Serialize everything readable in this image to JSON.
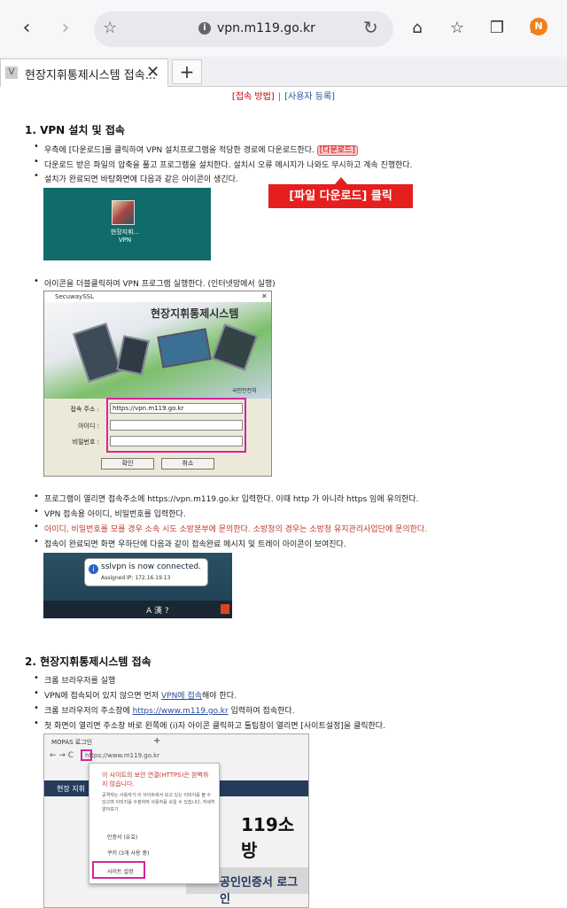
{
  "browser": {
    "url": "vpn.m119.go.kr",
    "tab_title": "현장지휘통제시스템 접속...",
    "tab_favicon": "V",
    "profile_badge": "N",
    "icons": [
      "back-arrow-icon",
      "forward-arrow-icon",
      "bookmark-star-icon",
      "site-info-icon",
      "reload-icon",
      "home-icon",
      "favorites-icon",
      "tabs-icon",
      "menu-icon"
    ]
  },
  "topnav": {
    "link1": "[접속 방법]",
    "sep": "|",
    "link2": "[사용자 등록]"
  },
  "section1": {
    "heading": "1. VPN 설치 및 접속",
    "items": [
      "우측에 [다운로드]를 클릭하여 VPN 설치프로그램을 적당한 경로에 다운로드한다.",
      "다운로드 받은 파일의 압축을 풀고 프로그램을 설치한다. 설치시 오류 메시지가 나와도 무시하고 계속 진행한다.",
      "설치가 완료되면 바탕화면에 다음과 같은 아이콘이 생긴다.",
      "아이콘을 더블클릭하여 VPN 프로그램 실행한다. (인터넷망에서 실행)",
      "프로그램이 열리면 접속주소에 https://vpn.m119.go.kr 입력한다. 이때 http 가 아니라 https 임에 유의한다.",
      "VPN 접속용 아이디, 비밀번호를 입력한다.",
      "아이디, 비밀번호를 모를 경우 소속 시도 소방본부에 문의한다. 소방청의 경우는 소방청 유지관리사업단에 문의한다.",
      "접속이 완료되면 화면 우하단에 다음과 같이 접속완료 메시지 및 트레이 아이콘이 보여진다."
    ],
    "download_btn": "[다운로드]",
    "callout": "[파일 다운로드] 클릭",
    "desktop_icon_label": "현장지휘...\nVPN"
  },
  "vpn_window": {
    "title": "SecuwaySSL",
    "banner_title": "현장지휘통제시스템",
    "org": "국민안전처",
    "addr_label": "접속 주소 :",
    "addr_value": "https://vpn.m119.go.kr",
    "id_label": "아이디 :",
    "pw_label": "비밀번호 :",
    "ok": "확인",
    "cancel": "취소"
  },
  "tray": {
    "msg": "sslvpn is now connected.",
    "ip": "Assigned IP: 172.16.19.13",
    "tray_text": "A 漢 ?"
  },
  "section2": {
    "heading": "2. 현장지휘통제시스템 접속",
    "item1": "크롬 브라우저를 실행",
    "item2_a": "VPN에 접속되어 있지 않으면 먼저 ",
    "item2_link": "VPN에 접속",
    "item2_b": "해야 한다.",
    "item3_a": "크롬 브라우저의 주소창에 ",
    "item3_link": "https://www.m119.go.kr",
    "item3_b": " 입력하여 접속한다.",
    "item4": "첫 화면이 열리면 주소창 바로 왼쪽에 (i)자 아이콘 클릭하고 툴팁창이 열리면 [사이트설정]을 클릭한다."
  },
  "chrome_shot": {
    "tab": "MOPAS 로그인",
    "plus": "+",
    "nav": "← → C",
    "addr": "https://www.m119.go.kr",
    "page_label": "현장 지휘",
    "big_text": "119소방",
    "cert_text": "공인인증서 로그인",
    "popup_title": "이 사이트의 보안 연결(HTTPS)은 완벽하지 않습니다.",
    "popup_desc": "공격자는 사용자가 이 사이트에서 보고 있는 이미지를 볼 수 있으며 이미지를 수정하여 사용자를 속일 수 있습니다. 자세히 알아보기",
    "item_cert": "인증서 (유효)",
    "item_cookie": "쿠키 (3개 사용 중)",
    "item_settings": "사이트 설정"
  }
}
